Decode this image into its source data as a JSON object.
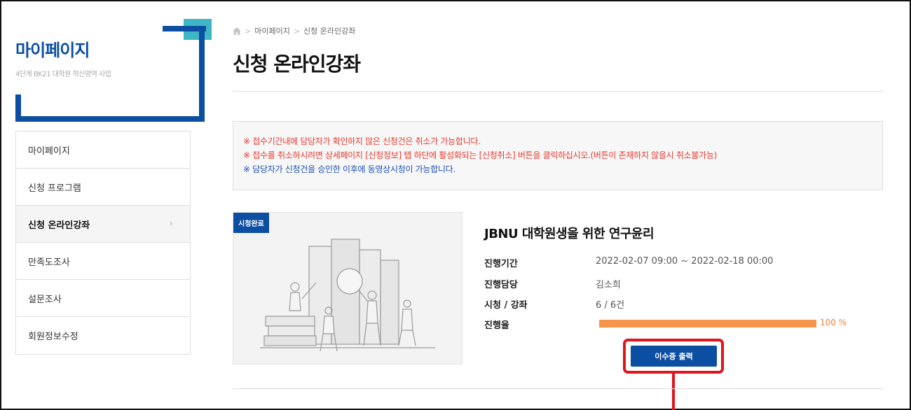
{
  "sidebar": {
    "title": "마이페이지",
    "subtitle": "4단계 BK21 대학원 혁신영역 사업",
    "items": [
      {
        "label": "마이페이지"
      },
      {
        "label": "신청 프로그램"
      },
      {
        "label": "신청 온라인강좌"
      },
      {
        "label": "만족도조사"
      },
      {
        "label": "설문조사"
      },
      {
        "label": "회원정보수정"
      }
    ],
    "active_index": 2
  },
  "breadcrumb": [
    "마이페이지",
    "신청 온라인강좌"
  ],
  "page_title": "신청 온라인강좌",
  "notice": {
    "line1": "※ 접수기간내에 담당자가 확인하지 않은 신청건은 취소가 가능합니다.",
    "line2": "※ 접수를 취소하시려면 상세페이지 [신청정보] 탭 하단에 활성화되는 [신청취소] 버튼을 클릭하십시오.(버튼이 존재하지 않을시 취소불가능)",
    "line3": "※ 담당자가 신청건을 승인한 이후에 동영상시청이 가능합니다."
  },
  "course": {
    "badge": "시청완료",
    "title": "JBNU 대학원생을 위한 연구윤리",
    "period_label": "진행기간",
    "period_value": "2022-02-07 09:00 ~ 2022-02-18 00:00",
    "manager_label": "진행담당",
    "manager_value": "김소희",
    "views_label": "시청 / 강좌",
    "views_value": "6 / 6건",
    "progress_label": "진행율",
    "progress_text": "100 %",
    "progress_percent": 100,
    "cert_button": "이수증 출력"
  },
  "colors": {
    "brand_blue": "#0b4ea2",
    "accent_teal": "#3fb6c5",
    "notice_red": "#e63a2e",
    "notice_blue": "#1d4fb5",
    "progress_orange": "#f5944a",
    "highlight_red": "#e0151c"
  },
  "icons": {
    "home": "home-icon",
    "chevron": "chevron-right-icon"
  }
}
